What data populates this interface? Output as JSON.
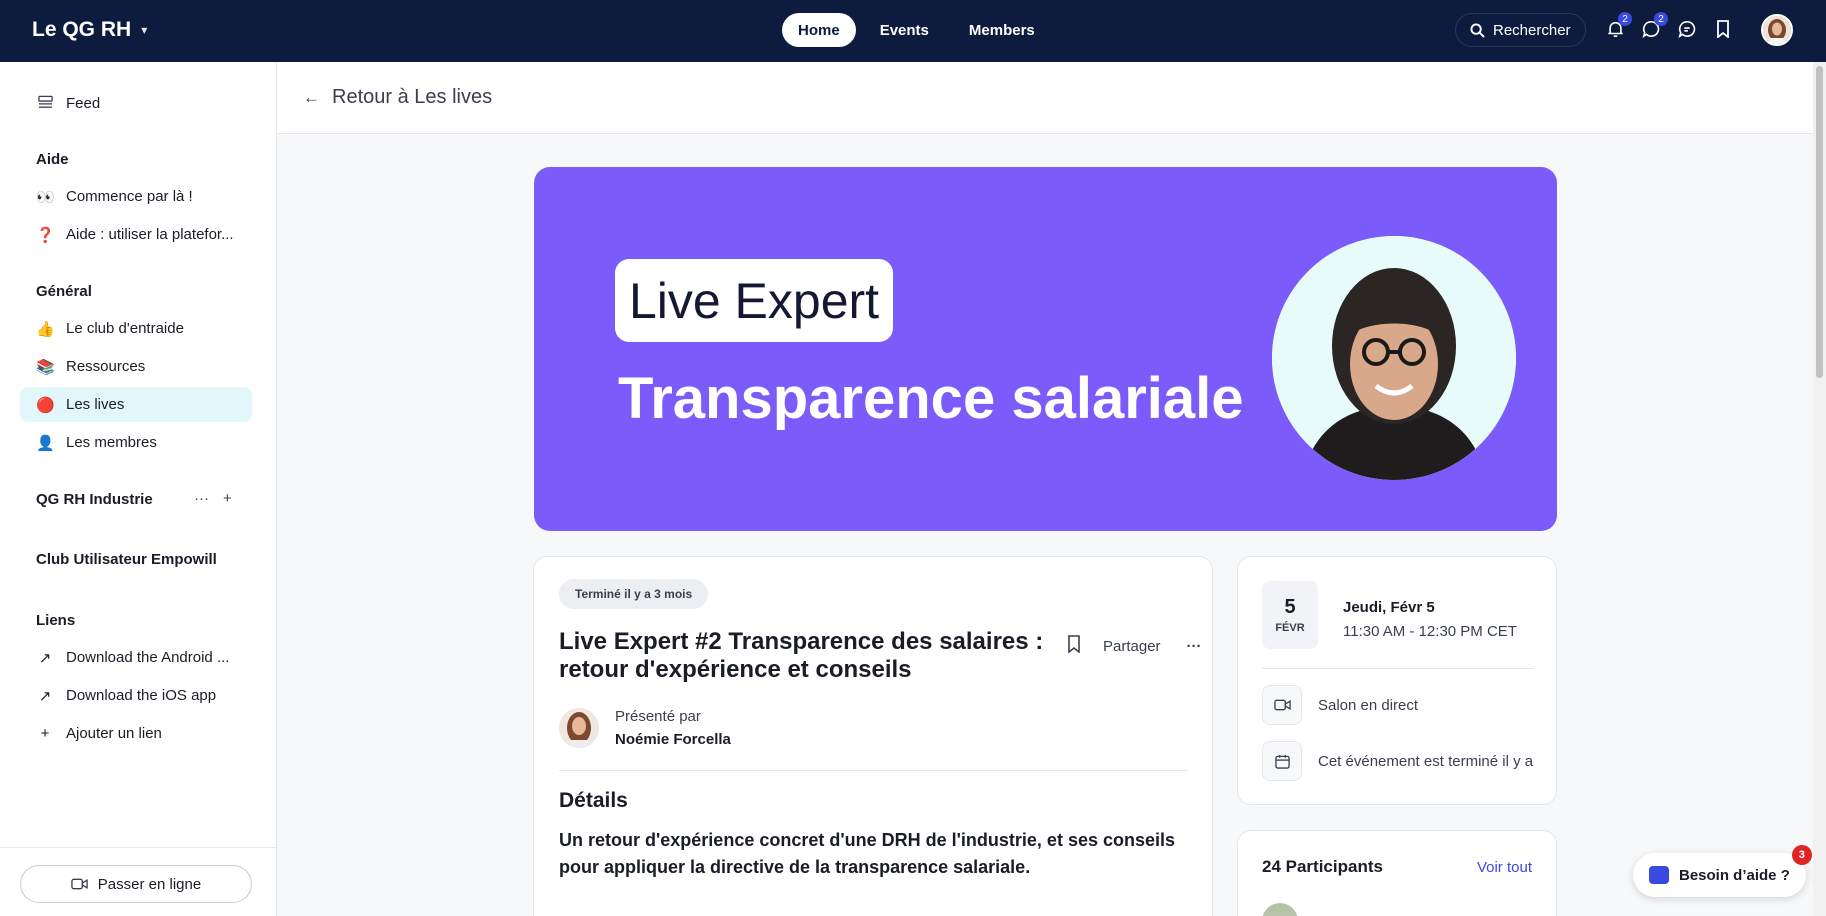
{
  "topbar": {
    "brand": "Le QG RH",
    "nav": [
      "Home",
      "Events",
      "Members"
    ],
    "search_label": "Rechercher",
    "notifications_count": "2",
    "messages_count": "2"
  },
  "sidebar": {
    "feed": "Feed",
    "section_aide": "Aide",
    "aide_items": [
      {
        "emoji": "👀",
        "label": "Commence par là !"
      },
      {
        "emoji": "❓",
        "label": "Aide : utiliser la platefor..."
      }
    ],
    "section_general": "Général",
    "general_items": [
      {
        "emoji": "👍",
        "label": "Le club d'entraide"
      },
      {
        "emoji": "📚",
        "label": "Ressources"
      },
      {
        "emoji": "🔴",
        "label": "Les lives"
      },
      {
        "emoji": "👤",
        "label": "Les membres"
      }
    ],
    "section_industrie": "QG RH Industrie",
    "section_club": "Club Utilisateur Empowill",
    "section_liens": "Liens",
    "liens_items": [
      {
        "icon": "↗",
        "label": "Download the Android ..."
      },
      {
        "icon": "↗",
        "label": "Download the iOS app"
      },
      {
        "icon": "+",
        "label": "Ajouter un lien"
      }
    ],
    "online_button": "Passer en ligne"
  },
  "header": {
    "back_label": "Retour à Les lives"
  },
  "hero": {
    "pill_text": "Live Expert",
    "title": "Transparence salariale",
    "bg_color": "#7b5cfa"
  },
  "event": {
    "status": "Terminé il y a 3 mois",
    "title": "Live Expert #2 Transparence des salaires : retour d'expérience et conseils",
    "share_label": "Partager",
    "presented_by": "Présenté par",
    "presenter_name": "Noémie Forcella",
    "details_heading": "Détails",
    "details_text": "Un retour d'expérience concret d'une DRH de l'industrie, et ses conseils pour appliquer la directive de la transparence salariale."
  },
  "date_card": {
    "day": "5",
    "month": "FÉVR",
    "date_label": "Jeudi, Févr 5",
    "time_label": "11:30 AM - 12:30 PM CET",
    "location": "Salon en direct",
    "ended_text": "Cet événement est terminé il y a"
  },
  "participants": {
    "title": "24 Participants",
    "see_all": "Voir tout"
  },
  "help": {
    "label": "Besoin d’aide ?",
    "badge": "3"
  }
}
